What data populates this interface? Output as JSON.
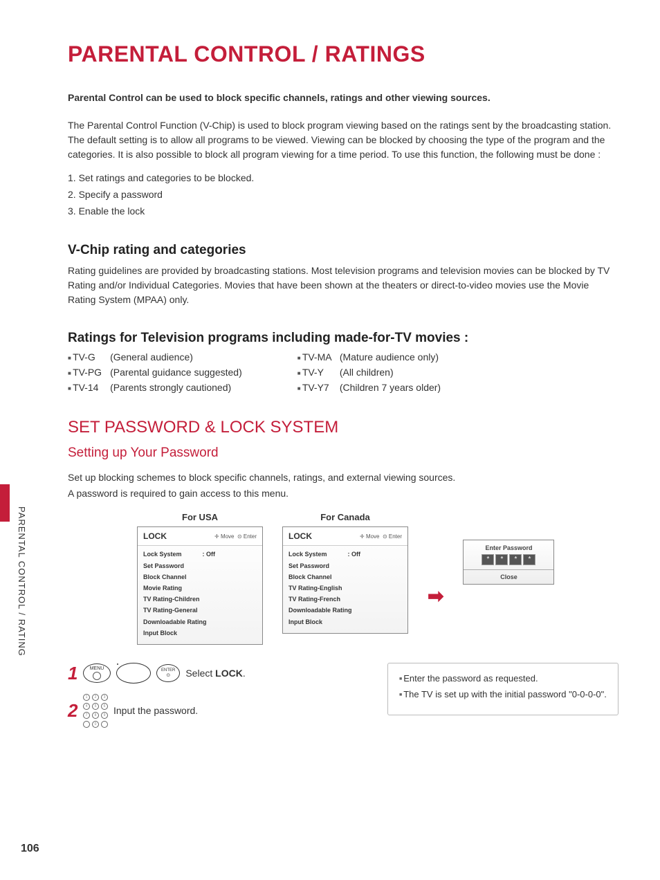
{
  "title": "PARENTAL CONTROL / RATINGS",
  "sidebar_label": "PARENTAL CONTROL / RATING",
  "page_number": "106",
  "intro_bold": "Parental Control can be used to block specific channels, ratings and other viewing sources.",
  "intro_body": "The Parental Control Function (V-Chip) is used to block program viewing based on the ratings sent by the broadcasting station. The default setting is to allow all programs to be viewed. Viewing can be blocked by choosing the type of the program and the categories. It is also possible to block all program viewing for a time period. To use this function, the following must be done :",
  "setup_steps": [
    "1. Set ratings and categories to be blocked.",
    "2. Specify a password",
    "3. Enable the lock"
  ],
  "vchip": {
    "heading": "V-Chip rating and categories",
    "body": "Rating guidelines are provided by broadcasting stations. Most television programs and television movies can be blocked by TV Rating and/or Individual Categories. Movies that have been shown at the theaters or direct-to-video movies use the Movie Rating System (MPAA) only."
  },
  "tv_ratings": {
    "heading": "Ratings for Television programs including made-for-TV movies :",
    "left": [
      {
        "code": "TV-G",
        "desc": "(General audience)"
      },
      {
        "code": "TV-PG",
        "desc": "(Parental guidance suggested)"
      },
      {
        "code": "TV-14",
        "desc": "(Parents strongly cautioned)"
      }
    ],
    "right": [
      {
        "code": "TV-MA",
        "desc": "(Mature audience only)"
      },
      {
        "code": "TV-Y",
        "desc": "(All children)"
      },
      {
        "code": "TV-Y7",
        "desc": "(Children 7 years older)"
      }
    ]
  },
  "section2": "SET PASSWORD & LOCK SYSTEM",
  "sub2": "Setting up Your Password",
  "pass_intro1": "Set up blocking schemes to block specific channels, ratings, and external viewing sources.",
  "pass_intro2": "A password is required to gain access to this menu.",
  "menus": {
    "usa": {
      "title": "For USA",
      "head": "LOCK",
      "hint_move": "Move",
      "hint_enter": "Enter",
      "items": [
        {
          "label": "Lock System",
          "value": ": Off"
        },
        {
          "label": "Set Password"
        },
        {
          "label": "Block Channel"
        },
        {
          "label": "Movie Rating"
        },
        {
          "label": "TV Rating-Children"
        },
        {
          "label": "TV Rating-General"
        },
        {
          "label": "Downloadable Rating"
        },
        {
          "label": "Input Block"
        }
      ]
    },
    "canada": {
      "title": "For Canada",
      "head": "LOCK",
      "hint_move": "Move",
      "hint_enter": "Enter",
      "items": [
        {
          "label": "Lock System",
          "value": ": Off"
        },
        {
          "label": "Set Password"
        },
        {
          "label": "Block Channel"
        },
        {
          "label": "TV Rating-English"
        },
        {
          "label": "TV Rating-French"
        },
        {
          "label": "Downloadable Rating"
        },
        {
          "label": "Input Block"
        }
      ]
    },
    "password": {
      "title": "Enter Password",
      "close": "Close"
    }
  },
  "instructions": {
    "step1": {
      "btn": "MENU",
      "btn2": "ENTER",
      "text_pre": "Select ",
      "text_strong": "LOCK",
      "text_post": "."
    },
    "step2": {
      "text": "Input the password."
    }
  },
  "notes": [
    "Enter the password as requested.",
    "The TV is set up with the initial password \"0-0-0-0\"."
  ]
}
